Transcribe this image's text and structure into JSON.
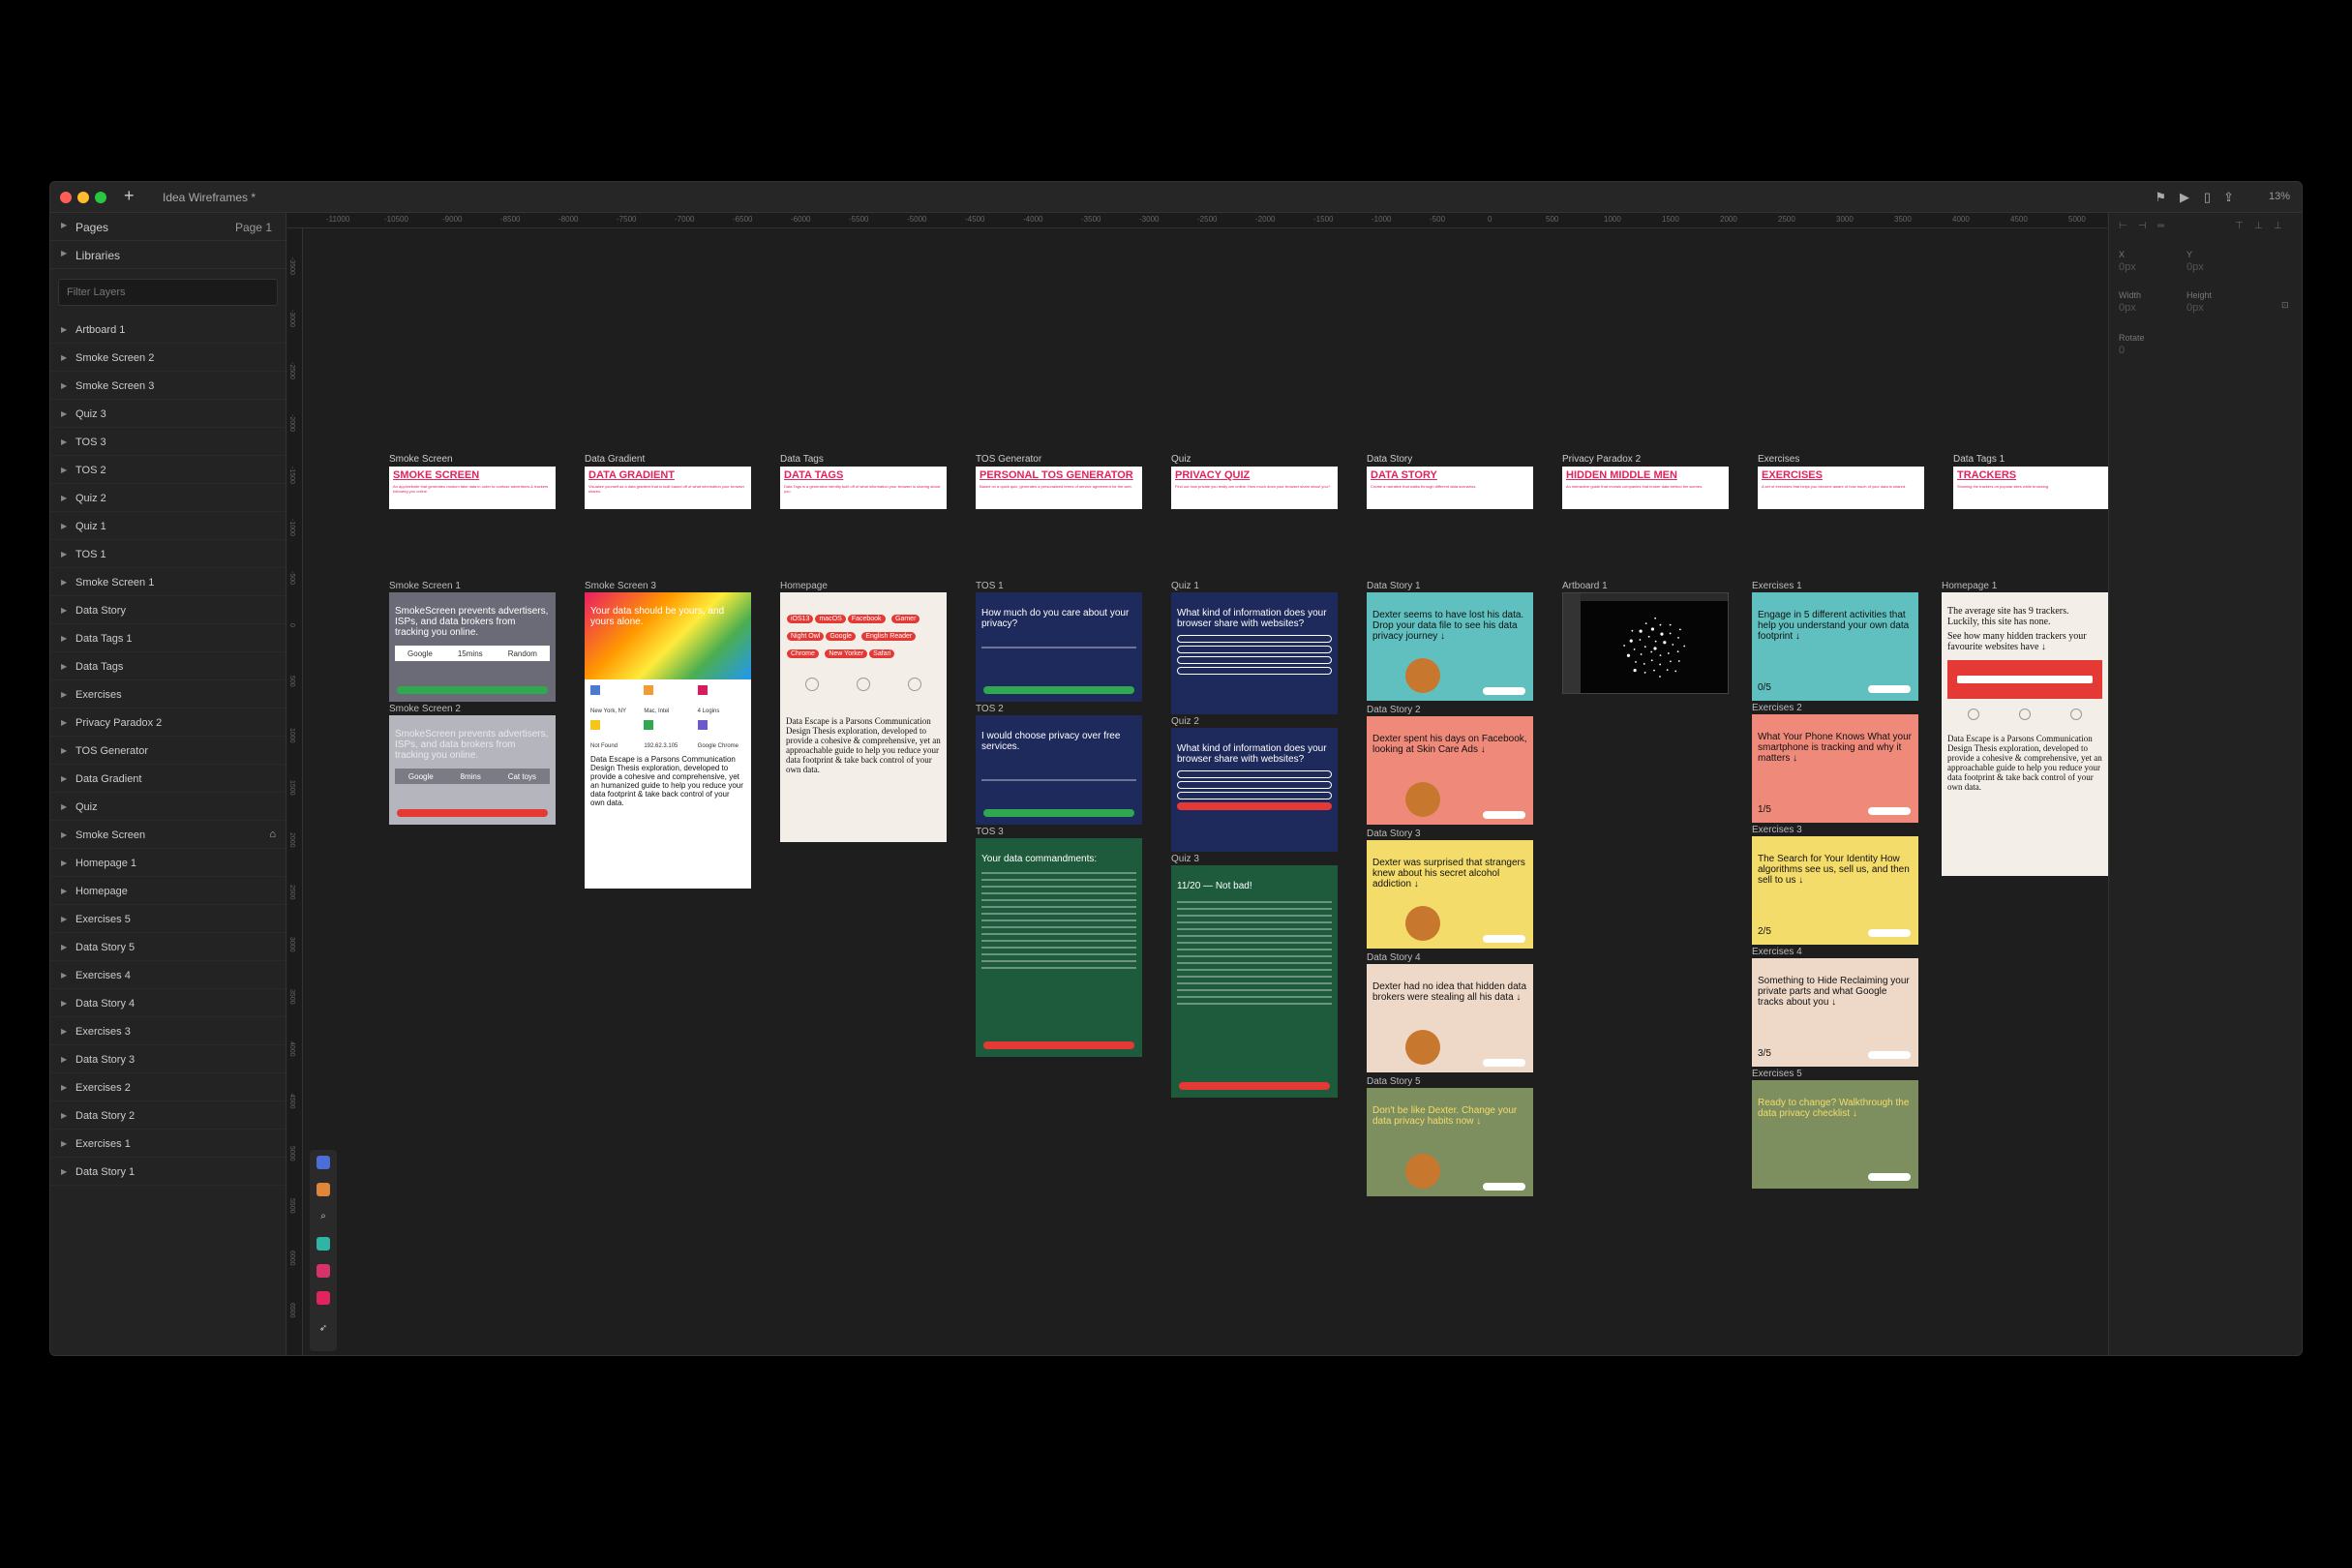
{
  "window": {
    "title": "Idea Wireframes *",
    "zoom": "13%"
  },
  "sidebar": {
    "pages_label": "Pages",
    "current_page": "Page 1",
    "libraries_label": "Libraries",
    "filter_placeholder": "Filter Layers",
    "layers": [
      "Artboard 1",
      "Smoke Screen 2",
      "Smoke Screen 3",
      "Quiz 3",
      "TOS 3",
      "TOS 2",
      "Quiz 2",
      "Quiz 1",
      "TOS 1",
      "Smoke Screen 1",
      "Data Story",
      "Data Tags 1",
      "Data Tags",
      "Exercises",
      "Privacy Paradox 2",
      "TOS Generator",
      "Data Gradient",
      "Quiz",
      "Smoke Screen",
      "Homepage 1",
      "Homepage",
      "Exercises 5",
      "Data Story 5",
      "Exercises 4",
      "Data Story 4",
      "Exercises 3",
      "Data Story 3",
      "Exercises 2",
      "Data Story 2",
      "Exercises 1",
      "Data Story 1"
    ]
  },
  "ruler_top": [
    "-11000",
    "-10500",
    "-9000",
    "-8500",
    "-8000",
    "-7500",
    "-7000",
    "-6500",
    "-6000",
    "-5500",
    "-5000",
    "-4500",
    "-4000",
    "-3500",
    "-3000",
    "-2500",
    "-2000",
    "-1500",
    "-1000",
    "-500",
    "0",
    "500",
    "1000",
    "1500",
    "2000",
    "2500",
    "3000",
    "3500",
    "4000",
    "4500",
    "5000"
  ],
  "ruler_left": [
    "-3500",
    "-3000",
    "-2500",
    "-2000",
    "-1500",
    "-1000",
    "-500",
    "0",
    "500",
    "1000",
    "1500",
    "2000",
    "2500",
    "3000",
    "3500",
    "4000",
    "4500",
    "5000",
    "5500",
    "6000",
    "6500",
    "7000"
  ],
  "inspector": {
    "x_label": "X",
    "x_value": "0px",
    "y_label": "Y",
    "y_value": "0px",
    "width_label": "Width",
    "width_value": "0px",
    "height_label": "Height",
    "height_value": "0px",
    "rotate_label": "Rotate",
    "rotate_value": "0"
  },
  "columns": [
    {
      "group": "Smoke Screen",
      "header": "SMOKE SCREEN",
      "sub": "An app/website that generates random fake data in order to confuse advertisers & trackers following you online."
    },
    {
      "group": "Data Gradient",
      "header": "DATA GRADIENT",
      "sub": "Visualize yourself as a data gradient that is built based off of what information your browser shares."
    },
    {
      "group": "Data Tags",
      "header": "DATA TAGS",
      "sub": "Data Tags is a generative identity built off of what information your browser is sharing about you."
    },
    {
      "group": "TOS Generator",
      "header": "PERSONAL TOS GENERATOR",
      "sub": "Based on a quick quiz, generates a personalized terms of service agreement for the web."
    },
    {
      "group": "Quiz",
      "header": "PRIVACY QUIZ",
      "sub": "Find out how private you really are online. How much does your browser share about you?"
    },
    {
      "group": "Data Story",
      "header": "DATA STORY",
      "sub": "Create a narrative that walks through different data scenarios."
    },
    {
      "group": "Privacy Paradox 2",
      "header": "HIDDEN MIDDLE MEN",
      "sub": "An interactive guide that reveals companies that broker data behind the scenes."
    },
    {
      "group": "Exercises",
      "header": "EXERCISES",
      "sub": "A set of exercises that helps you become aware of how much of your data is shared."
    },
    {
      "group": "Data Tags 1",
      "header": "TRACKERS",
      "sub": "Showing the trackers on popular sites while browsing."
    }
  ],
  "smoke": {
    "s1_label": "Smoke Screen 1",
    "s1_text": "SmokeScreen prevents advertisers, ISPs, and data brokers from tracking you online.",
    "s1_opts": [
      "Google",
      "15mins",
      "Random"
    ],
    "s2_label": "Smoke Screen 2",
    "s2_text": "SmokeScreen prevents advertisers, ISPs, and data brokers from tracking you online.",
    "s2_opts": [
      "Google",
      "8mins",
      "Cat toys"
    ]
  },
  "gradient": {
    "label": "Smoke Screen 3",
    "hero": "Your data should be yours, and yours alone.",
    "cells": [
      "New York, NY",
      "Mac, Intel",
      "4 Logins",
      "Not Found",
      "192.62.3.105",
      "Google Chrome"
    ],
    "body": "Data Escape is a Parsons Communication Design Thesis exploration, developed to provide a cohesive and comprehensive, yet an humanized guide to help you reduce your data footprint & take back control of your own data."
  },
  "tags": {
    "label": "Homepage",
    "pills": [
      "iOS13",
      "macOS",
      "Facebook",
      "Gamer",
      "Night Owl",
      "Google",
      "English Reader",
      "Chrome",
      "New Yorker",
      "Safari"
    ],
    "body": "Data Escape is a Parsons Communication Design Thesis exploration, developed to provide a cohesive & comprehensive, yet an approachable guide to help you reduce your data footprint & take back control of your own data."
  },
  "tos": {
    "t1_label": "TOS 1",
    "t1_q": "How much do you care about your privacy?",
    "t2_label": "TOS 2",
    "t2_q": "I would choose privacy over free services.",
    "t3_label": "TOS 3",
    "t3_q": "Your data commandments:"
  },
  "quiz": {
    "q1_label": "Quiz 1",
    "q1_q": "What kind of information does your browser share with websites?",
    "q2_label": "Quiz 2",
    "q2_q": "What kind of information does your browser share with websites?",
    "q3_label": "Quiz 3",
    "q3_q": "11/20 — Not bad!"
  },
  "story": [
    {
      "label": "Data Story 1",
      "text": "Dexter seems to have lost his data. Drop your data file to see his data privacy journey ↓"
    },
    {
      "label": "Data Story 2",
      "text": "Dexter spent his days on Facebook, looking at Skin Care Ads ↓"
    },
    {
      "label": "Data Story 3",
      "text": "Dexter was surprised that strangers knew about his secret alcohol addiction ↓"
    },
    {
      "label": "Data Story 4",
      "text": "Dexter had no idea that hidden data brokers were stealing all his data ↓"
    },
    {
      "label": "Data Story 5",
      "text": "Don't be like Dexter. Change your data privacy habits now ↓"
    }
  ],
  "paradox": {
    "label": "Artboard 1"
  },
  "exercises": [
    {
      "label": "Exercises 1",
      "text": "Engage in 5 different activities that help you understand your own data footprint ↓",
      "count": "0/5"
    },
    {
      "label": "Exercises 2",
      "text": "What Your Phone Knows What your smartphone is tracking and why it matters ↓",
      "count": "1/5"
    },
    {
      "label": "Exercises 3",
      "text": "The Search for Your Identity How algorithms see us, sell us, and then sell to us ↓",
      "count": "2/5"
    },
    {
      "label": "Exercises 4",
      "text": "Something to Hide Reclaiming your private parts and what Google tracks about you ↓",
      "count": "3/5"
    },
    {
      "label": "Exercises 5",
      "text": "Ready to change? Walkthrough the data privacy checklist ↓",
      "count": ""
    }
  ],
  "trackers": {
    "label": "Homepage 1",
    "headline": "The average site has 9 trackers. Luckily, this site has none.",
    "sub": "See how many hidden trackers your favourite websites have ↓",
    "body": "Data Escape is a Parsons Communication Design Thesis exploration, developed to provide a cohesive & comprehensive, yet an approachable guide to help you reduce your data footprint & take back control of your own data."
  },
  "colors": {
    "accent": "#e0245e",
    "tos_bg": "#1f2a5c",
    "tos3_bg": "#1e5b3c",
    "green": "#2fa84f",
    "red": "#e53935"
  }
}
